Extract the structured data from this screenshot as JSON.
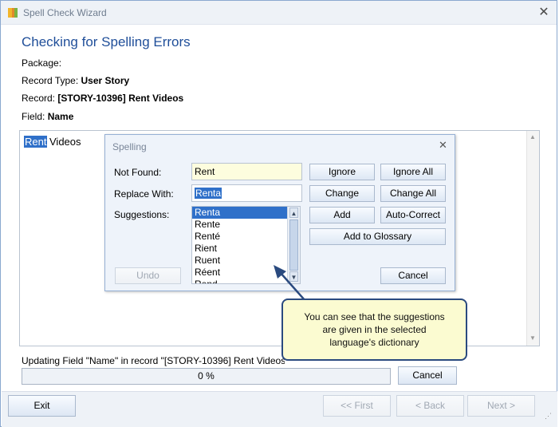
{
  "window": {
    "title": "Spell Check Wizard",
    "close_glyph": "✕"
  },
  "header": {
    "heading": "Checking for Spelling Errors",
    "package_label": "Package:",
    "package_value": "",
    "record_type_label": "Record Type:",
    "record_type_value": "User Story",
    "record_label": "Record:",
    "record_value": "[STORY-10396] Rent Videos",
    "field_label": "Field:",
    "field_value": "Name"
  },
  "editor": {
    "selected_word": "Rent",
    "rest_text": "Videos"
  },
  "spelling_dialog": {
    "title": "Spelling",
    "close_glyph": "✕",
    "not_found_label": "Not Found:",
    "not_found_value": "Rent",
    "replace_with_label": "Replace With:",
    "replace_with_value": "Renta",
    "suggestions_label": "Suggestions:",
    "suggestions": [
      "Renta",
      "Rente",
      "Renté",
      "Rient",
      "Ruent",
      "Réent",
      "Rend"
    ],
    "selected_suggestion_index": 0,
    "buttons": {
      "ignore": "Ignore",
      "ignore_all": "Ignore All",
      "change": "Change",
      "change_all": "Change All",
      "add": "Add",
      "auto_correct": "Auto-Correct",
      "add_to_glossary": "Add to Glossary",
      "undo": "Undo",
      "cancel": "Cancel"
    }
  },
  "callout": {
    "line1": "You can see that the suggestions",
    "line2": "are given in the selected",
    "line3": "language's dictionary"
  },
  "progress": {
    "status_text": "Updating Field \"Name\" in record \"[STORY-10396] Rent Videos\"",
    "percent_text": "0 %",
    "percent": 0,
    "cancel": "Cancel"
  },
  "footer": {
    "exit": "Exit",
    "first": "<< First",
    "back": "< Back",
    "next": "Next >",
    "finish": ""
  },
  "colors": {
    "heading": "#1f4e99",
    "selection": "#2f70c9",
    "callout_bg": "#fbfbd1",
    "callout_border": "#2a4a7f"
  }
}
